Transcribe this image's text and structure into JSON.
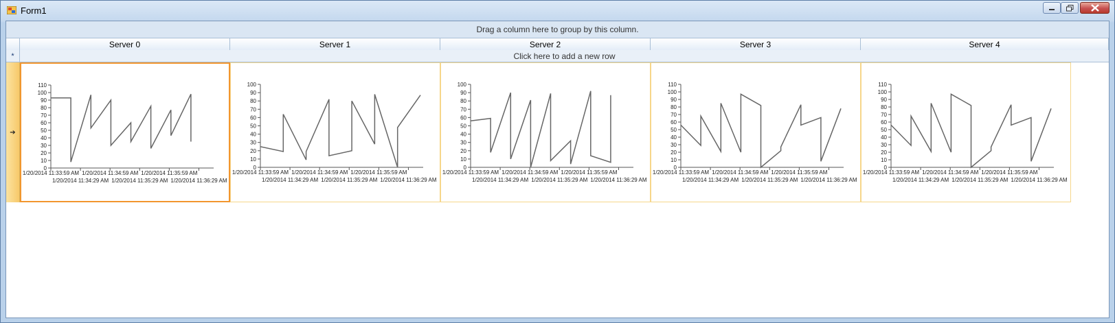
{
  "window": {
    "title": "Form1"
  },
  "grid": {
    "group_panel_text": "Drag a column here to group by this column.",
    "new_row_text": "Click here to add a new row",
    "new_row_glyph": "*",
    "current_row_glyph": "➔",
    "columns": [
      "Server 0",
      "Server 1",
      "Server 2",
      "Server 3",
      "Server 4"
    ]
  },
  "chart_data": [
    {
      "type": "line",
      "yticks": [
        0,
        10,
        20,
        30,
        40,
        50,
        60,
        70,
        80,
        90,
        100,
        110
      ],
      "ylim": [
        0,
        110
      ],
      "xticks_top": [
        "1/20/2014 11:33:59 AM",
        "1/20/2014 11:34:59 AM",
        "1/20/2014 11:35:59 AM"
      ],
      "xticks_bottom": [
        "1/20/2014 11:34:29 AM",
        "1/20/2014 11:35:29 AM",
        "1/20/2014 11:36:29 AM"
      ],
      "x": [
        0,
        0,
        1,
        1,
        2,
        2,
        3,
        3,
        4,
        4,
        5,
        5
      ],
      "y": [
        93,
        93,
        8,
        97,
        53,
        90,
        30,
        60,
        35,
        82,
        26,
        77,
        43,
        98,
        35
      ]
    },
    {
      "type": "line",
      "yticks": [
        0,
        10,
        20,
        30,
        40,
        50,
        60,
        70,
        80,
        90,
        100
      ],
      "ylim": [
        0,
        100
      ],
      "xticks_top": [
        "1/20/2014 11:33:59 AM",
        "1/20/2014 11:34:59 AM",
        "1/20/2014 11:35:59 AM"
      ],
      "xticks_bottom": [
        "1/20/2014 11:34:29 AM",
        "1/20/2014 11:35:29 AM",
        "1/20/2014 11:36:29 AM"
      ],
      "y": [
        25,
        19,
        64,
        9,
        19,
        82,
        14,
        20,
        80,
        28,
        88,
        0,
        48,
        87
      ]
    },
    {
      "type": "line",
      "yticks": [
        0,
        10,
        20,
        30,
        40,
        50,
        60,
        70,
        80,
        90,
        100
      ],
      "ylim": [
        0,
        100
      ],
      "xticks_top": [
        "1/20/2014 11:33:59 AM",
        "1/20/2014 11:34:59 AM",
        "1/20/2014 11:35:59 AM"
      ],
      "xticks_bottom": [
        "1/20/2014 11:34:29 AM",
        "1/20/2014 11:35:29 AM",
        "1/20/2014 11:36:29 AM"
      ],
      "y": [
        56,
        59,
        18,
        90,
        10,
        81,
        0,
        89,
        8,
        32,
        4,
        92,
        14,
        6,
        87
      ]
    },
    {
      "type": "line",
      "yticks": [
        0,
        10,
        20,
        30,
        40,
        50,
        60,
        70,
        80,
        90,
        100,
        110
      ],
      "ylim": [
        0,
        110
      ],
      "xticks_top": [
        "1/20/2014 11:33:59 AM",
        "1/20/2014 11:34:59 AM",
        "1/20/2014 11:35:59 AM"
      ],
      "xticks_bottom": [
        "1/20/2014 11:34:29 AM",
        "1/20/2014 11:35:29 AM",
        "1/20/2014 11:36:29 AM"
      ],
      "y": [
        56,
        29,
        68,
        21,
        85,
        20,
        97,
        82,
        0,
        22,
        27,
        83,
        56,
        66,
        8,
        78
      ]
    },
    {
      "type": "line",
      "yticks": [
        0,
        10,
        20,
        30,
        40,
        50,
        60,
        70,
        80,
        90,
        100,
        110
      ],
      "ylim": [
        0,
        110
      ],
      "xticks_top": [
        "1/20/2014 11:33:59 AM",
        "1/20/2014 11:34:59 AM",
        "1/20/2014 11:35:59 AM"
      ],
      "xticks_bottom": [
        "1/20/2014 11:34:29 AM",
        "1/20/2014 11:35:29 AM",
        "1/20/2014 11:36:29 AM"
      ],
      "y": [
        56,
        29,
        68,
        21,
        85,
        20,
        97,
        82,
        0,
        22,
        27,
        83,
        56,
        66,
        8,
        78
      ]
    }
  ]
}
